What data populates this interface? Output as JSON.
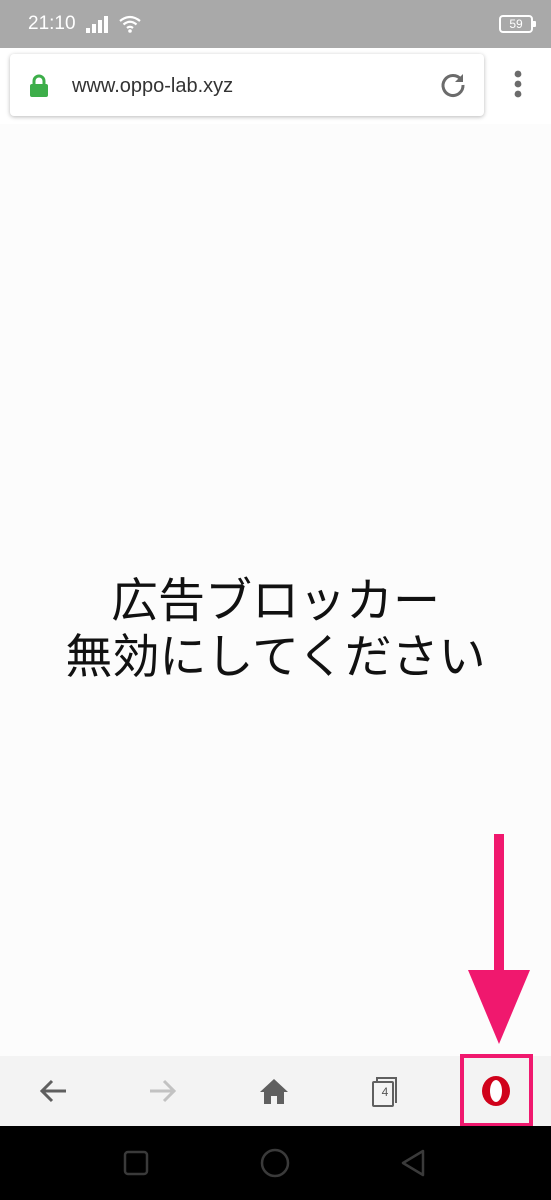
{
  "status_bar": {
    "time": "21:10",
    "battery_level": "59",
    "icons": [
      "signal-icon",
      "wifi-icon",
      "battery-icon"
    ]
  },
  "toolbar": {
    "url": "www.oppo-lab.xyz",
    "icons": [
      "lock-icon",
      "reload-icon",
      "overflow-menu-icon"
    ]
  },
  "content": {
    "message_line1": "広告ブロッカー",
    "message_line2": "無効にしてください"
  },
  "bottom_nav": {
    "items": [
      {
        "name": "back",
        "icon": "arrow-left-icon",
        "enabled": true
      },
      {
        "name": "forward",
        "icon": "arrow-right-icon",
        "enabled": false
      },
      {
        "name": "home",
        "icon": "home-icon",
        "enabled": true
      },
      {
        "name": "tabs",
        "icon": "tabs-icon",
        "count": "4",
        "enabled": true
      },
      {
        "name": "opera-menu",
        "icon": "opera-logo-icon",
        "enabled": true
      }
    ]
  },
  "system_nav": {
    "items": [
      "recents-icon",
      "home-circle-icon",
      "back-triangle-icon"
    ]
  },
  "colors": {
    "status_bar_bg": "#a9a9a9",
    "lock_green": "#3dae4a",
    "annotation_pink": "#f0186e",
    "opera_red": "#d0021b",
    "nav_bg": "#f3f3f3",
    "system_nav_bg": "#000000"
  }
}
